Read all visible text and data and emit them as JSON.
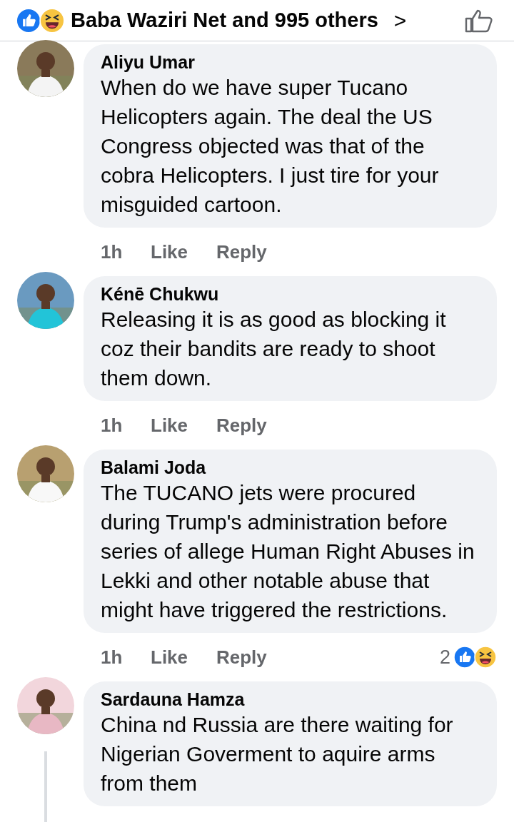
{
  "header": {
    "reactions_text": "Baba Waziri Net and 995 others",
    "chevron": ">"
  },
  "comments": [
    {
      "author": "Aliyu Umar",
      "text": "When do we have super Tucano Helicopters again. The deal the US Congress objected was that of the cobra Helicopters. I just tire for your misguided cartoon.",
      "time": "1h",
      "like": "Like",
      "reply": "Reply",
      "thread": false
    },
    {
      "author": "Kénē Chukwu",
      "text": "Releasing it is as good as blocking it coz their bandits are ready to shoot them down.",
      "time": "1h",
      "like": "Like",
      "reply": "Reply",
      "thread": false
    },
    {
      "author": "Balami Joda",
      "text": "The TUCANO jets were procured during Trump's administration before series of allege Human Right Abuses in Lekki and other notable abuse that might have triggered the restrictions.",
      "time": "1h",
      "like": "Like",
      "reply": "Reply",
      "reaction_count": "2",
      "thread": false
    },
    {
      "author": "Sardauna Hamza",
      "text": "China nd Russia are there waiting for Nigerian Goverment to aquire arms from them",
      "thread": true
    }
  ]
}
